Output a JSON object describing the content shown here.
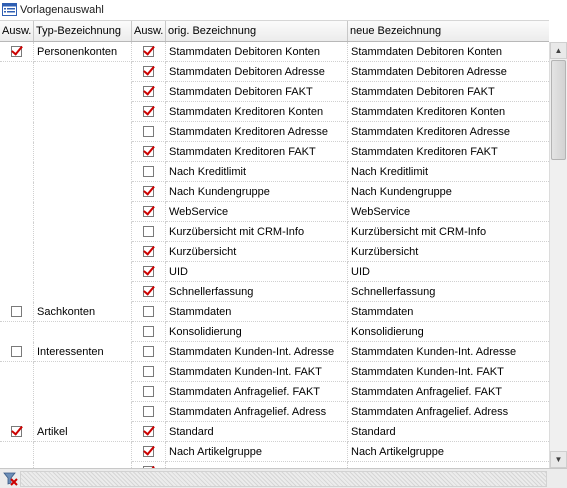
{
  "window": {
    "title": "Vorlagenauswahl"
  },
  "columns": [
    "Ausw.",
    "Typ-Bezeichnung",
    "Ausw.",
    "orig. Bezeichnung",
    "neue Bezeichnung"
  ],
  "rows": [
    {
      "type_checked": true,
      "type": "Personenkonten",
      "checked": true,
      "orig": "Stammdaten Debitoren Konten",
      "neu": "Stammdaten Debitoren Konten"
    },
    {
      "type_checked": null,
      "type": "",
      "checked": true,
      "orig": "Stammdaten Debitoren Adresse",
      "neu": "Stammdaten Debitoren Adresse"
    },
    {
      "type_checked": null,
      "type": "",
      "checked": true,
      "orig": "Stammdaten Debitoren FAKT",
      "neu": "Stammdaten Debitoren FAKT"
    },
    {
      "type_checked": null,
      "type": "",
      "checked": true,
      "orig": "Stammdaten Kreditoren Konten",
      "neu": "Stammdaten Kreditoren Konten"
    },
    {
      "type_checked": null,
      "type": "",
      "checked": false,
      "orig": "Stammdaten Kreditoren Adresse",
      "neu": "Stammdaten Kreditoren Adresse"
    },
    {
      "type_checked": null,
      "type": "",
      "checked": true,
      "orig": "Stammdaten Kreditoren FAKT",
      "neu": "Stammdaten Kreditoren FAKT"
    },
    {
      "type_checked": null,
      "type": "",
      "checked": false,
      "orig": "Nach Kreditlimit",
      "neu": "Nach Kreditlimit"
    },
    {
      "type_checked": null,
      "type": "",
      "checked": true,
      "orig": "Nach Kundengruppe",
      "neu": "Nach Kundengruppe"
    },
    {
      "type_checked": null,
      "type": "",
      "checked": true,
      "orig": "WebService",
      "neu": "WebService"
    },
    {
      "type_checked": null,
      "type": "",
      "checked": false,
      "orig": "Kurzübersicht mit CRM-Info",
      "neu": "Kurzübersicht mit CRM-Info"
    },
    {
      "type_checked": null,
      "type": "",
      "checked": true,
      "orig": "Kurzübersicht",
      "neu": "Kurzübersicht"
    },
    {
      "type_checked": null,
      "type": "",
      "checked": true,
      "orig": "UID",
      "neu": "UID"
    },
    {
      "type_checked": null,
      "type": "",
      "checked": true,
      "orig": "Schnellerfassung",
      "neu": "Schnellerfassung"
    },
    {
      "type_checked": false,
      "type": "Sachkonten",
      "checked": false,
      "orig": "Stammdaten",
      "neu": "Stammdaten"
    },
    {
      "type_checked": null,
      "type": "",
      "checked": false,
      "orig": "Konsolidierung",
      "neu": "Konsolidierung"
    },
    {
      "type_checked": false,
      "type": "Interessenten",
      "checked": false,
      "orig": "Stammdaten Kunden-Int. Adresse",
      "neu": "Stammdaten Kunden-Int. Adresse"
    },
    {
      "type_checked": null,
      "type": "",
      "checked": false,
      "orig": "Stammdaten Kunden-Int. FAKT",
      "neu": "Stammdaten Kunden-Int. FAKT"
    },
    {
      "type_checked": null,
      "type": "",
      "checked": false,
      "orig": "Stammdaten Anfragelief. FAKT",
      "neu": "Stammdaten Anfragelief. FAKT"
    },
    {
      "type_checked": null,
      "type": "",
      "checked": false,
      "orig": "Stammdaten Anfragelief. Adress",
      "neu": "Stammdaten Anfragelief. Adress"
    },
    {
      "type_checked": true,
      "type": "Artikel",
      "checked": true,
      "orig": "Standard",
      "neu": "Standard"
    },
    {
      "type_checked": null,
      "type": "",
      "checked": true,
      "orig": "Nach Artikelgruppe",
      "neu": "Nach Artikelgruppe"
    },
    {
      "type_checked": null,
      "type": "",
      "checked": true,
      "orig": "",
      "neu": ""
    }
  ],
  "scrollbar": {
    "up_arrow": "▲",
    "down_arrow": "▼"
  },
  "colors": {
    "check": "#cc0000",
    "header_bg": "#ececec"
  },
  "icons": {
    "window": "list-window-icon",
    "filter": "filter-clear-icon"
  }
}
